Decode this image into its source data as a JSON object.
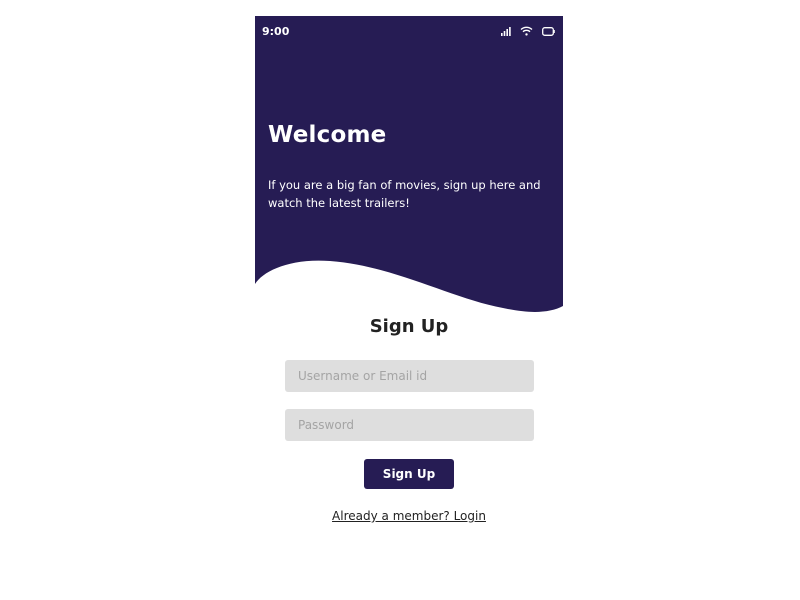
{
  "colors": {
    "primary": "#261c54",
    "background": "#ffffff",
    "input_bg": "#dedede",
    "text_dark": "#222222"
  },
  "status_bar": {
    "time": "9:00",
    "icons": [
      "signal-icon",
      "wifi-icon",
      "battery-icon"
    ]
  },
  "hero": {
    "title": "Welcome",
    "description": "If you are a big fan of movies, sign up here and watch the latest trailers!"
  },
  "form": {
    "title": "Sign Up",
    "username": {
      "placeholder": "Username or Email id",
      "value": ""
    },
    "password": {
      "placeholder": "Password",
      "value": ""
    },
    "submit_label": "Sign Up",
    "login_link": "Already a member? Login"
  }
}
